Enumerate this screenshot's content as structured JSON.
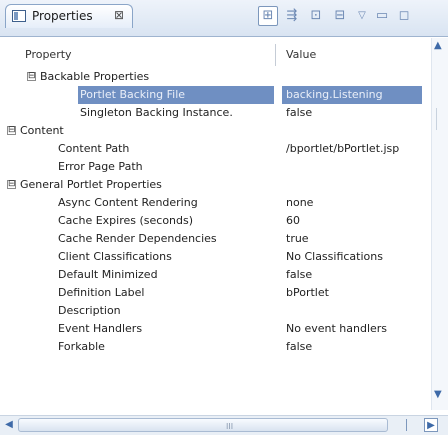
{
  "view": {
    "tab_title": "Properties",
    "tab_close": "⊠"
  },
  "toolbar": {
    "icons": [
      "tree-view-icon",
      "categories-icon",
      "filter-icon",
      "advanced-icon",
      "view-menu-icon",
      "minimize-icon",
      "maximize-icon"
    ]
  },
  "table": {
    "col_property": "Property",
    "col_value": "Value",
    "rows": [
      {
        "name": "Backable Properties",
        "value": "",
        "expander": "⊟"
      },
      {
        "name": "Portlet Backing File",
        "value": "backing.Listening",
        "selected": true
      },
      {
        "name": "Singleton Backing Instance.",
        "value": "false"
      },
      {
        "name": "Content",
        "value": "",
        "expander": "⊟"
      },
      {
        "name": "Content Path",
        "value": "/bportlet/bPortlet.jsp"
      },
      {
        "name": "Error Page Path",
        "value": ""
      },
      {
        "name": "General Portlet Properties",
        "value": "",
        "expander": "⊟"
      },
      {
        "name": "Async Content Rendering",
        "value": "none"
      },
      {
        "name": "Cache Expires (seconds)",
        "value": "60"
      },
      {
        "name": "Cache Render Dependencies",
        "value": "true"
      },
      {
        "name": "Client Classifications",
        "value": "No Classifications"
      },
      {
        "name": "Default Minimized",
        "value": "false"
      },
      {
        "name": "Definition Label",
        "value": "bPortlet"
      },
      {
        "name": "Description",
        "value": ""
      },
      {
        "name": "Event Handlers",
        "value": "No event handlers"
      },
      {
        "name": "Forkable",
        "value": "false"
      }
    ]
  },
  "scroll": {
    "grip": "III"
  }
}
